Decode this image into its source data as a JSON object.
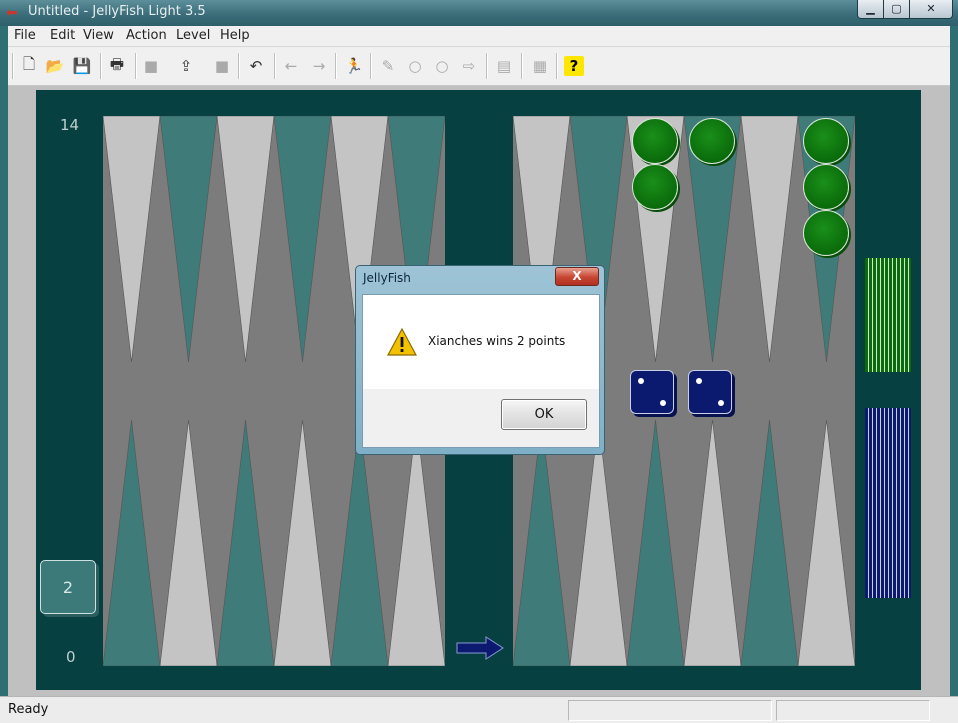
{
  "window": {
    "title": "Untitled - JellyFish Light 3.5"
  },
  "menu": [
    "File",
    "Edit",
    "View",
    "Action",
    "Level",
    "Help"
  ],
  "toolbar_icons": [
    "new-icon",
    "open-icon",
    "save-icon",
    "print-icon",
    "stop-icon",
    "upload-icon",
    "stop-icon-2",
    "undo-icon",
    "back-arrow-icon",
    "forward-arrow-icon",
    "runner-icon",
    "pencil-icon",
    "circle-icon",
    "circle-icon-2",
    "right-arrow-icon",
    "ruler-icon",
    "grid-icon",
    "help-icon"
  ],
  "board": {
    "pip_count_top": "14",
    "pip_count_bottom": "0",
    "cube_value": "2",
    "dice": [
      2,
      2
    ],
    "colors": {
      "board": "#064040",
      "light_point": "#c4c4c4",
      "dark_point": "#3f7b79",
      "checker_green": "#0a6b0a",
      "checker_blue": "#0b1a6e"
    }
  },
  "dialog": {
    "title": "JellyFish",
    "close_label": "X",
    "message": "Xianches wins 2 points",
    "ok_label": "OK"
  },
  "status": {
    "text": "Ready"
  }
}
